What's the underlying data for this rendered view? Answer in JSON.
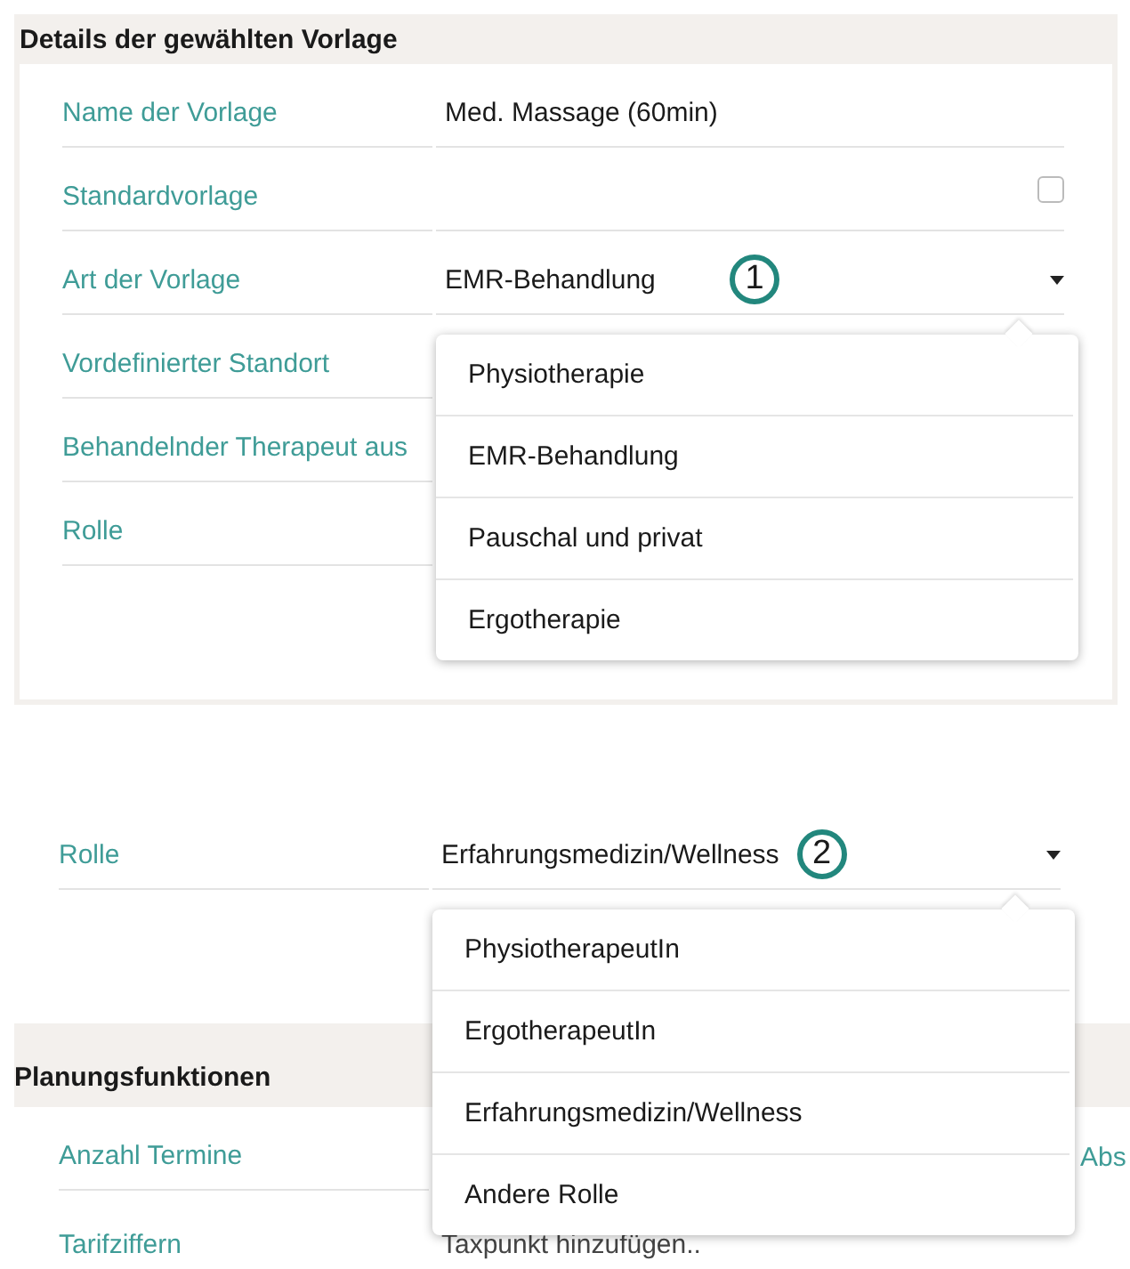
{
  "template_details": {
    "title": "Details der gewählten Vorlage",
    "fields": [
      {
        "label": "Name der Vorlage",
        "kind": "text",
        "value": "Med. Massage (60min)"
      },
      {
        "label": "Standardvorlage",
        "kind": "checkbox",
        "checked": false
      },
      {
        "label": "Art der Vorlage",
        "kind": "select",
        "value": "EMR-Behandlung",
        "callout": "1",
        "open": true,
        "options": [
          "Physiotherapie",
          "EMR-Behandlung",
          "Pauschal und privat",
          "Ergotherapie"
        ]
      },
      {
        "label": "Vordefinierter Standort",
        "kind": "select"
      },
      {
        "label": "Behandelnder Therapeut aus",
        "kind": "select"
      },
      {
        "label": "Rolle",
        "kind": "select"
      }
    ]
  },
  "role_panel": {
    "fields": [
      {
        "label": "Rolle",
        "kind": "select",
        "value": "Erfahrungsmedizin/Wellness",
        "callout": "2",
        "open": true,
        "options": [
          "PhysiotherapeutIn",
          "ErgotherapeutIn",
          "Erfahrungsmedizin/Wellness",
          "Andere Rolle"
        ]
      }
    ]
  },
  "planning": {
    "title": "Planungsfunktionen",
    "fields": [
      {
        "label": "Anzahl Termine",
        "kind": "text",
        "column_3": "Abs"
      },
      {
        "label": "Tarifziffern",
        "kind": "text",
        "placeholder": "Taxpunkt hinzufügen.."
      }
    ]
  }
}
